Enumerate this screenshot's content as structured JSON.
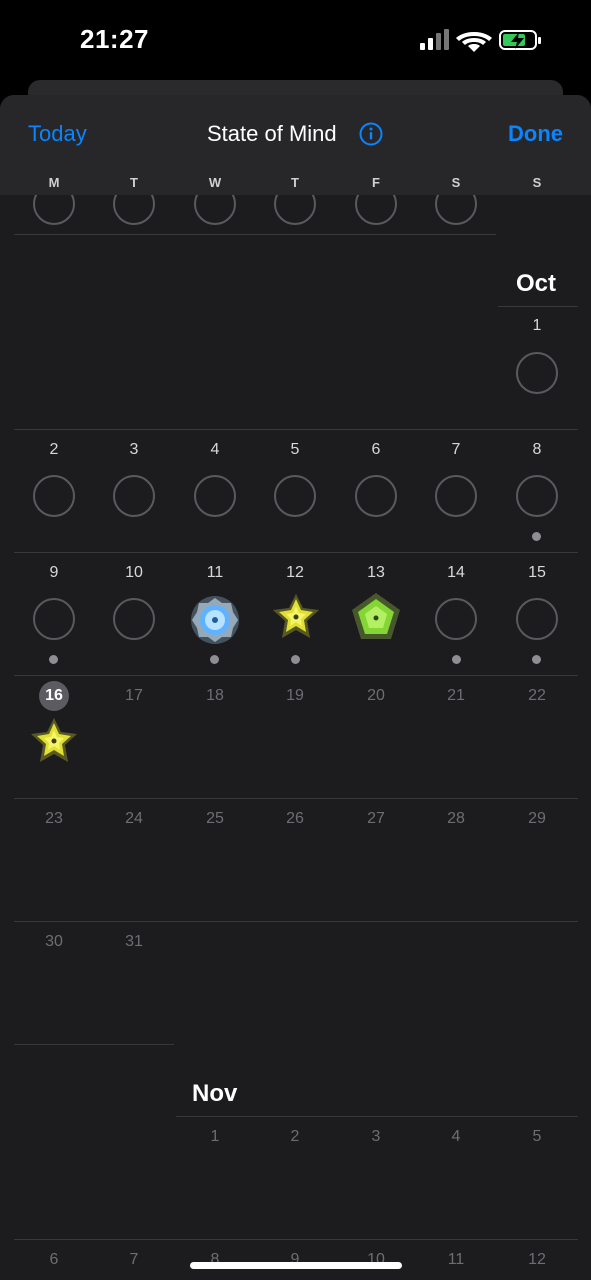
{
  "status_bar": {
    "time": "21:27"
  },
  "header": {
    "today_label": "Today",
    "title": "State of Mind",
    "done_label": "Done"
  },
  "weekdays": [
    "M",
    "T",
    "W",
    "T",
    "F",
    "S",
    "S"
  ],
  "october": {
    "label": "Oct",
    "row1": [
      "1"
    ],
    "row2": [
      "2",
      "3",
      "4",
      "5",
      "6",
      "7",
      "8"
    ],
    "row3": [
      "9",
      "10",
      "11",
      "12",
      "13",
      "14",
      "15"
    ],
    "row4": [
      "16",
      "17",
      "18",
      "19",
      "20",
      "21",
      "22"
    ],
    "row5": [
      "23",
      "24",
      "25",
      "26",
      "27",
      "28",
      "29"
    ],
    "row6": [
      "30",
      "31"
    ]
  },
  "november": {
    "label": "Nov",
    "row1": [
      "1",
      "2",
      "3",
      "4",
      "5"
    ],
    "row2": [
      "6",
      "7",
      "8",
      "9",
      "10",
      "11",
      "12"
    ]
  },
  "moods": {
    "oct11": {
      "shape": "blue-flower",
      "color": "#7ec8ff"
    },
    "oct12": {
      "shape": "yellow-star",
      "color": "#e6e23a"
    },
    "oct13": {
      "shape": "green-pentagon",
      "color": "#8ee03a"
    },
    "oct16": {
      "shape": "yellow-star",
      "color": "#e6e23a"
    }
  },
  "colors": {
    "accent": "#0a84ff",
    "background": "#1c1c1e"
  }
}
